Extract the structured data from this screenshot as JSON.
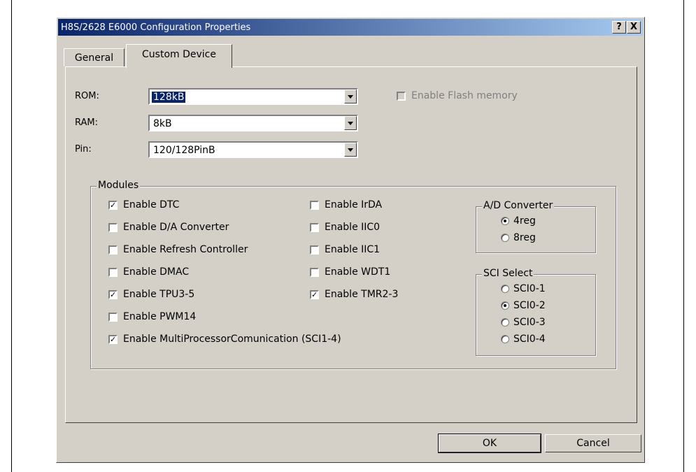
{
  "window": {
    "title": "H8S/2628 E6000 Configuration Properties",
    "help": "?",
    "close": "X"
  },
  "tabs": [
    {
      "label": "General"
    },
    {
      "label": "Custom Device"
    }
  ],
  "rom": {
    "label": "ROM:",
    "value": "128kB"
  },
  "ram": {
    "label": "RAM:",
    "value": "8kB"
  },
  "pin": {
    "label": "Pin:",
    "value": "120/128PinB"
  },
  "flash": {
    "label": "Enable Flash memory",
    "checked": false,
    "disabled": true
  },
  "modules": {
    "legend": "Modules",
    "left": [
      {
        "label": "Enable DTC",
        "checked": true
      },
      {
        "label": "Enable D/A Converter",
        "checked": false
      },
      {
        "label": "Enable Refresh Controller",
        "checked": false
      },
      {
        "label": "Enable DMAC",
        "checked": false
      },
      {
        "label": "Enable TPU3-5",
        "checked": true
      },
      {
        "label": "Enable PWM14",
        "checked": false
      },
      {
        "label": "Enable MultiProcessorComunication (SCI1-4)",
        "checked": true
      }
    ],
    "right": [
      {
        "label": "Enable IrDA",
        "checked": false
      },
      {
        "label": "Enable IIC0",
        "checked": false
      },
      {
        "label": "Enable IIC1",
        "checked": false
      },
      {
        "label": "Enable WDT1",
        "checked": false
      },
      {
        "label": "Enable TMR2-3",
        "checked": true
      }
    ]
  },
  "ad_converter": {
    "legend": "A/D Converter",
    "options": [
      {
        "label": "4reg",
        "selected": true
      },
      {
        "label": "8reg",
        "selected": false
      }
    ]
  },
  "sci_select": {
    "legend": "SCI Select",
    "options": [
      {
        "label": "SCI0-1",
        "selected": false
      },
      {
        "label": "SCI0-2",
        "selected": true
      },
      {
        "label": "SCI0-3",
        "selected": false
      },
      {
        "label": "SCI0-4",
        "selected": false
      }
    ]
  },
  "buttons": {
    "ok": "OK",
    "cancel": "Cancel"
  }
}
